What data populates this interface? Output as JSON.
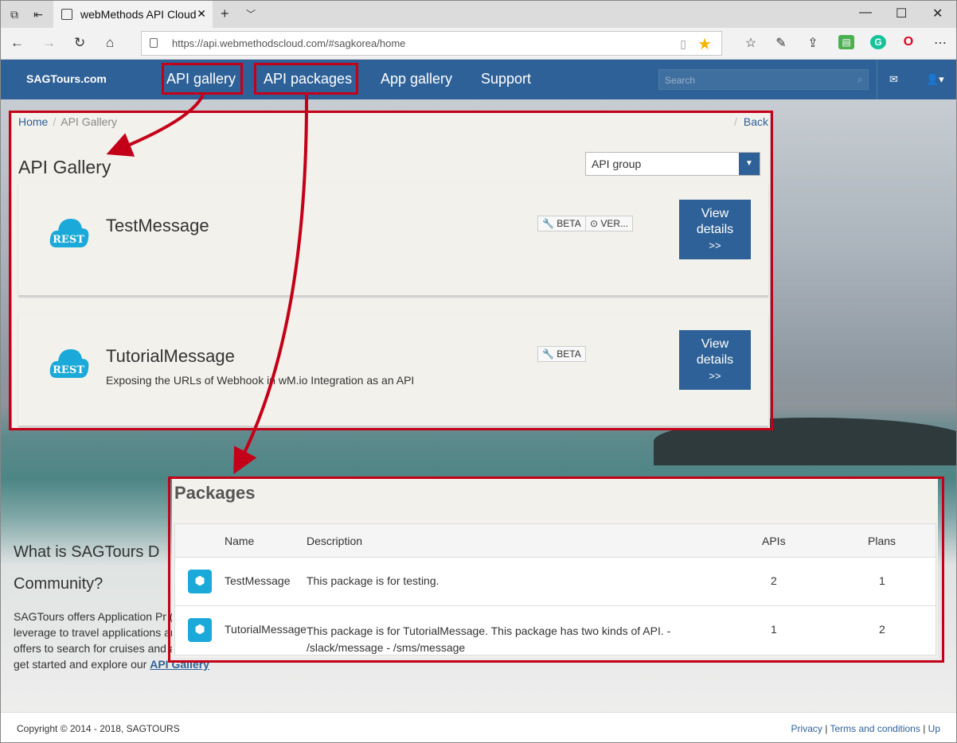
{
  "browser": {
    "tab_title": "webMethods API Cloud",
    "url": "https://api.webmethodscloud.com/#sagkorea/home"
  },
  "header": {
    "brand": "SAGTours.com",
    "nav": [
      "API gallery",
      "API packages",
      "App gallery",
      "Support"
    ],
    "search_placeholder": "Search"
  },
  "gallery": {
    "breadcrumb": [
      "Home",
      "API Gallery"
    ],
    "back": "Back",
    "title": "API Gallery",
    "filter_value": "API group",
    "apis": [
      {
        "icon_label": "REST",
        "name": "TestMessage",
        "description": "",
        "badges": [
          "BETA",
          "VER..."
        ],
        "button": [
          "View",
          "details",
          ">>"
        ]
      },
      {
        "icon_label": "REST",
        "name": "TutorialMessage",
        "description": "Exposing the URLs of Webhook in wM.io Integration as an API",
        "badges": [
          "BETA"
        ],
        "button": [
          "View",
          "details",
          ">>"
        ]
      }
    ]
  },
  "intro": {
    "heading_line1": "What is SAGTours D",
    "heading_line2": "Community?",
    "paragraph": "SAGTours offers Application Pr (APIs) that you can leverage to travel applications and access a SAGTours offers to search for cruises and arrange bookings. Now get started and explore our",
    "link": "API Gallery"
  },
  "packages": {
    "title": "Packages",
    "columns": [
      "Name",
      "Description",
      "APIs",
      "Plans"
    ],
    "rows": [
      {
        "name": "TestMessage",
        "description": "This package is for testing.",
        "apis": "2",
        "plans": "1"
      },
      {
        "name": "TutorialMessage",
        "description": "This package is for TutorialMessage. This package has two kinds of API. - /slack/message - /sms/message",
        "apis": "1",
        "plans": "2"
      }
    ]
  },
  "footer": {
    "copyright": "Copyright © 2014 - 2018, SAGTOURS",
    "links": [
      "Privacy",
      "Terms and conditions",
      "Up"
    ]
  },
  "colors": {
    "brand": "#2e6197",
    "annotation": "#c40018",
    "package_icon": "#1aa9d8"
  }
}
